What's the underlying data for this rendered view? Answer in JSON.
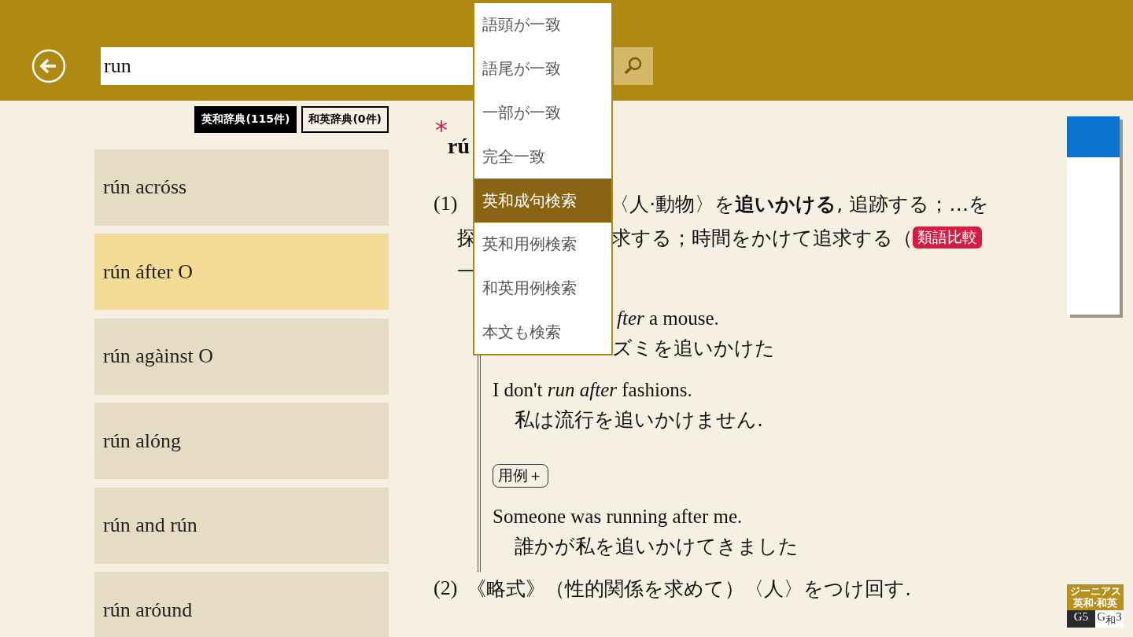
{
  "header": {
    "search": {
      "value": "run"
    },
    "search_modes": [
      {
        "label": "語頭が一致",
        "selected": false
      },
      {
        "label": "語尾が一致",
        "selected": false
      },
      {
        "label": "一部が一致",
        "selected": false
      },
      {
        "label": "完全一致",
        "selected": false
      },
      {
        "label": "英和成句検索",
        "selected": true
      },
      {
        "label": "英和用例検索",
        "selected": false
      },
      {
        "label": "和英用例検索",
        "selected": false
      },
      {
        "label": "本文も検索",
        "selected": false
      }
    ]
  },
  "dictionary_tabs": [
    {
      "label": "英和辞典(115件)",
      "selected": true
    },
    {
      "label": "和英辞典(0件)",
      "selected": false
    }
  ],
  "results": [
    {
      "label": "rún acróss",
      "selected": false
    },
    {
      "label": "rún áfter O",
      "selected": true
    },
    {
      "label": "rún agàinst O",
      "selected": false
    },
    {
      "label": "rún alóng",
      "selected": false
    },
    {
      "label": "rún and rún",
      "selected": false
    },
    {
      "label": "rún aróund",
      "selected": false
    }
  ],
  "entry": {
    "headword": "rú",
    "star": "*",
    "sense_1": {
      "number": "(1)",
      "line_1": "〈人·動物〉を**追いかける**, 追跡する；…を",
      "line_2_start": "探",
      "line_2": "求する；時間をかけて追求する（",
      "tag": "類語比較",
      "line_3": "—",
      "examples": [
        {
          "en": "*fter* a mouse.",
          "ja": "ズミを追いかけた"
        },
        {
          "en": "I don't *run after* fashions.",
          "ja": "私は流行を追いかけません."
        }
      ],
      "more_button": "用例＋",
      "more_examples": [
        {
          "en": "Someone was running after me.",
          "ja": "誰かが私を追いかけてきました"
        }
      ]
    },
    "sense_2": {
      "number": "(2)",
      "text": "《略式》（性的関係を求めて）〈人〉をつけ回す."
    }
  },
  "logo": {
    "title": "ジーニアス",
    "subtitle": "英和·和英",
    "edition_1": "G5",
    "edition_2": "G$_{和}$3"
  }
}
